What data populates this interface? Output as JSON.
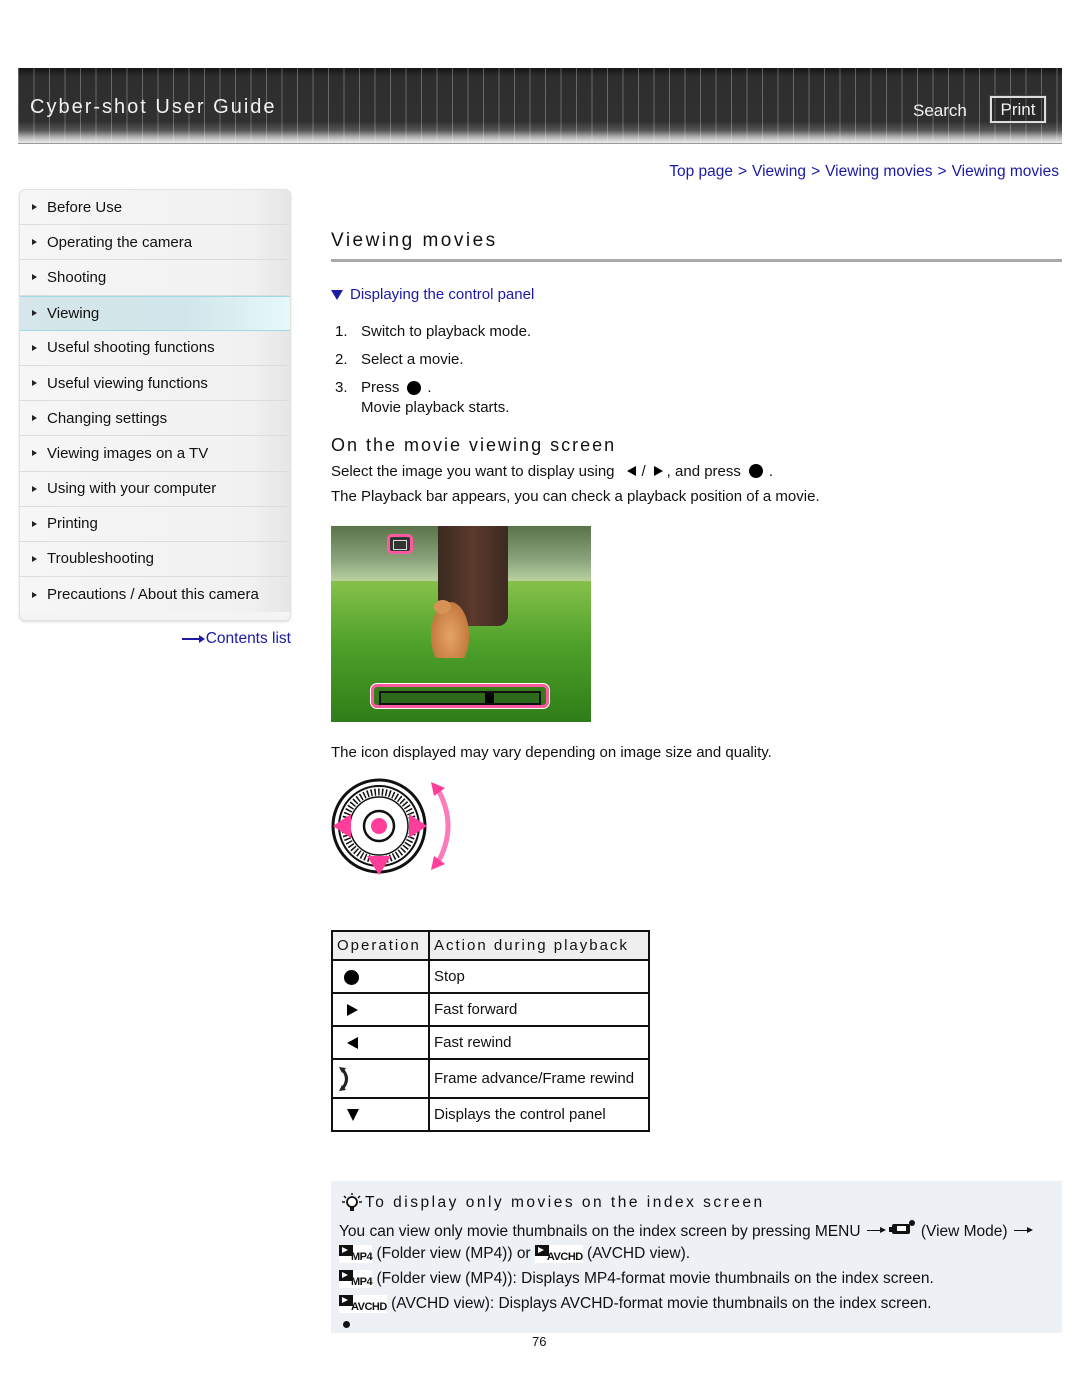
{
  "header": {
    "title": "Cyber-shot User Guide",
    "search_label": "Search",
    "print_label": "Print"
  },
  "breadcrumb": [
    "Top page",
    "Viewing",
    "Viewing movies",
    "Viewing movies"
  ],
  "breadcrumb_separator": ">",
  "sidebar": {
    "items": [
      {
        "label": "Before Use",
        "active": false
      },
      {
        "label": "Operating the camera",
        "active": false
      },
      {
        "label": "Shooting",
        "active": false
      },
      {
        "label": "Viewing",
        "active": true
      },
      {
        "label": "Useful shooting functions",
        "active": false
      },
      {
        "label": "Useful viewing functions",
        "active": false
      },
      {
        "label": "Changing settings",
        "active": false
      },
      {
        "label": "Viewing images on a TV",
        "active": false
      },
      {
        "label": "Using with your computer",
        "active": false
      },
      {
        "label": "Printing",
        "active": false
      },
      {
        "label": "Troubleshooting",
        "active": false
      },
      {
        "label": "Precautions / About this camera",
        "active": false
      }
    ],
    "contents_link": "Contents list"
  },
  "main": {
    "title": "Viewing movies",
    "anchor_link": "Displaying the control panel",
    "steps": [
      {
        "num": "1.",
        "text": "Switch to playback mode."
      },
      {
        "num": "2.",
        "text": "Select a movie."
      },
      {
        "num": "3.",
        "text": "Press",
        "icon": "center-button-icon",
        "suffix": "."
      }
    ],
    "step_note": "Movie playback starts.",
    "subheading": "On the movie viewing screen",
    "para1_prefix": "Select the image you want to display using",
    "para1_slash": "/",
    "para1_middle": ", and press",
    "para1_suffix": ".",
    "para2": "The Playback bar appears, you can check a playback position of a movie.",
    "screenshot_playback_position": 0.7,
    "image_note": "The icon displayed may vary depending on image size and quality.",
    "table": {
      "headers": [
        "Operation",
        "Action during playback"
      ],
      "rows": [
        {
          "icon": "center-button-icon",
          "action": "Stop"
        },
        {
          "icon": "right-arrow-icon",
          "action": "Fast forward"
        },
        {
          "icon": "left-arrow-icon",
          "action": "Fast rewind"
        },
        {
          "icon": "control-wheel-rotate-icon",
          "action": "Frame advance/Frame rewind"
        },
        {
          "icon": "down-arrow-icon",
          "action": "Displays the control panel"
        }
      ]
    },
    "tip": {
      "title": "To display only movies on the index screen",
      "line1_prefix": "You can view only movie thumbnails on the index screen by pressing MENU",
      "line1_view_mode": "(View Mode)",
      "line2_a": "(Folder view (MP4)) or",
      "line2_b": "(AVCHD view).",
      "line3": "(Folder view (MP4)): Displays MP4-format movie thumbnails on the index screen.",
      "line4": "(AVCHD view): Displays AVCHD-format movie thumbnails on the index screen.",
      "mp4_icon_text": "MP4",
      "avchd_icon_text": "AVCHD"
    }
  },
  "page_number": "76",
  "colors": {
    "link": "#1a1aa6",
    "accent_pink": "#ff3d9a",
    "active_nav": "#d0e6ea",
    "tip_bg": "#edf0f5"
  }
}
